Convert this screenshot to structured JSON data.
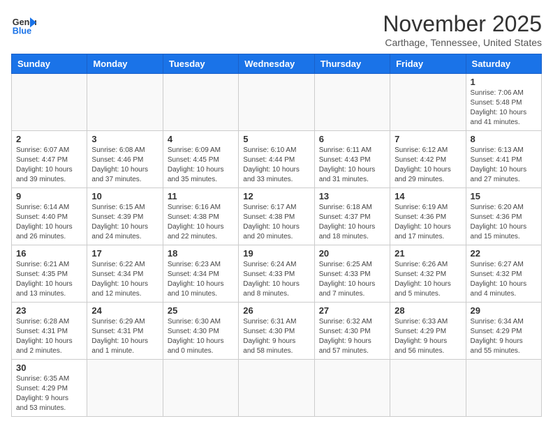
{
  "header": {
    "logo_general": "General",
    "logo_blue": "Blue",
    "month_title": "November 2025",
    "location": "Carthage, Tennessee, United States"
  },
  "weekdays": [
    "Sunday",
    "Monday",
    "Tuesday",
    "Wednesday",
    "Thursday",
    "Friday",
    "Saturday"
  ],
  "days": [
    {
      "num": "",
      "info": ""
    },
    {
      "num": "",
      "info": ""
    },
    {
      "num": "",
      "info": ""
    },
    {
      "num": "",
      "info": ""
    },
    {
      "num": "",
      "info": ""
    },
    {
      "num": "",
      "info": ""
    },
    {
      "num": "1",
      "info": "Sunrise: 7:06 AM\nSunset: 5:48 PM\nDaylight: 10 hours\nand 41 minutes."
    },
    {
      "num": "2",
      "info": "Sunrise: 6:07 AM\nSunset: 4:47 PM\nDaylight: 10 hours\nand 39 minutes."
    },
    {
      "num": "3",
      "info": "Sunrise: 6:08 AM\nSunset: 4:46 PM\nDaylight: 10 hours\nand 37 minutes."
    },
    {
      "num": "4",
      "info": "Sunrise: 6:09 AM\nSunset: 4:45 PM\nDaylight: 10 hours\nand 35 minutes."
    },
    {
      "num": "5",
      "info": "Sunrise: 6:10 AM\nSunset: 4:44 PM\nDaylight: 10 hours\nand 33 minutes."
    },
    {
      "num": "6",
      "info": "Sunrise: 6:11 AM\nSunset: 4:43 PM\nDaylight: 10 hours\nand 31 minutes."
    },
    {
      "num": "7",
      "info": "Sunrise: 6:12 AM\nSunset: 4:42 PM\nDaylight: 10 hours\nand 29 minutes."
    },
    {
      "num": "8",
      "info": "Sunrise: 6:13 AM\nSunset: 4:41 PM\nDaylight: 10 hours\nand 27 minutes."
    },
    {
      "num": "9",
      "info": "Sunrise: 6:14 AM\nSunset: 4:40 PM\nDaylight: 10 hours\nand 26 minutes."
    },
    {
      "num": "10",
      "info": "Sunrise: 6:15 AM\nSunset: 4:39 PM\nDaylight: 10 hours\nand 24 minutes."
    },
    {
      "num": "11",
      "info": "Sunrise: 6:16 AM\nSunset: 4:38 PM\nDaylight: 10 hours\nand 22 minutes."
    },
    {
      "num": "12",
      "info": "Sunrise: 6:17 AM\nSunset: 4:38 PM\nDaylight: 10 hours\nand 20 minutes."
    },
    {
      "num": "13",
      "info": "Sunrise: 6:18 AM\nSunset: 4:37 PM\nDaylight: 10 hours\nand 18 minutes."
    },
    {
      "num": "14",
      "info": "Sunrise: 6:19 AM\nSunset: 4:36 PM\nDaylight: 10 hours\nand 17 minutes."
    },
    {
      "num": "15",
      "info": "Sunrise: 6:20 AM\nSunset: 4:36 PM\nDaylight: 10 hours\nand 15 minutes."
    },
    {
      "num": "16",
      "info": "Sunrise: 6:21 AM\nSunset: 4:35 PM\nDaylight: 10 hours\nand 13 minutes."
    },
    {
      "num": "17",
      "info": "Sunrise: 6:22 AM\nSunset: 4:34 PM\nDaylight: 10 hours\nand 12 minutes."
    },
    {
      "num": "18",
      "info": "Sunrise: 6:23 AM\nSunset: 4:34 PM\nDaylight: 10 hours\nand 10 minutes."
    },
    {
      "num": "19",
      "info": "Sunrise: 6:24 AM\nSunset: 4:33 PM\nDaylight: 10 hours\nand 8 minutes."
    },
    {
      "num": "20",
      "info": "Sunrise: 6:25 AM\nSunset: 4:33 PM\nDaylight: 10 hours\nand 7 minutes."
    },
    {
      "num": "21",
      "info": "Sunrise: 6:26 AM\nSunset: 4:32 PM\nDaylight: 10 hours\nand 5 minutes."
    },
    {
      "num": "22",
      "info": "Sunrise: 6:27 AM\nSunset: 4:32 PM\nDaylight: 10 hours\nand 4 minutes."
    },
    {
      "num": "23",
      "info": "Sunrise: 6:28 AM\nSunset: 4:31 PM\nDaylight: 10 hours\nand 2 minutes."
    },
    {
      "num": "24",
      "info": "Sunrise: 6:29 AM\nSunset: 4:31 PM\nDaylight: 10 hours\nand 1 minute."
    },
    {
      "num": "25",
      "info": "Sunrise: 6:30 AM\nSunset: 4:30 PM\nDaylight: 10 hours\nand 0 minutes."
    },
    {
      "num": "26",
      "info": "Sunrise: 6:31 AM\nSunset: 4:30 PM\nDaylight: 9 hours\nand 58 minutes."
    },
    {
      "num": "27",
      "info": "Sunrise: 6:32 AM\nSunset: 4:30 PM\nDaylight: 9 hours\nand 57 minutes."
    },
    {
      "num": "28",
      "info": "Sunrise: 6:33 AM\nSunset: 4:29 PM\nDaylight: 9 hours\nand 56 minutes."
    },
    {
      "num": "29",
      "info": "Sunrise: 6:34 AM\nSunset: 4:29 PM\nDaylight: 9 hours\nand 55 minutes."
    },
    {
      "num": "30",
      "info": "Sunrise: 6:35 AM\nSunset: 4:29 PM\nDaylight: 9 hours\nand 53 minutes."
    }
  ]
}
